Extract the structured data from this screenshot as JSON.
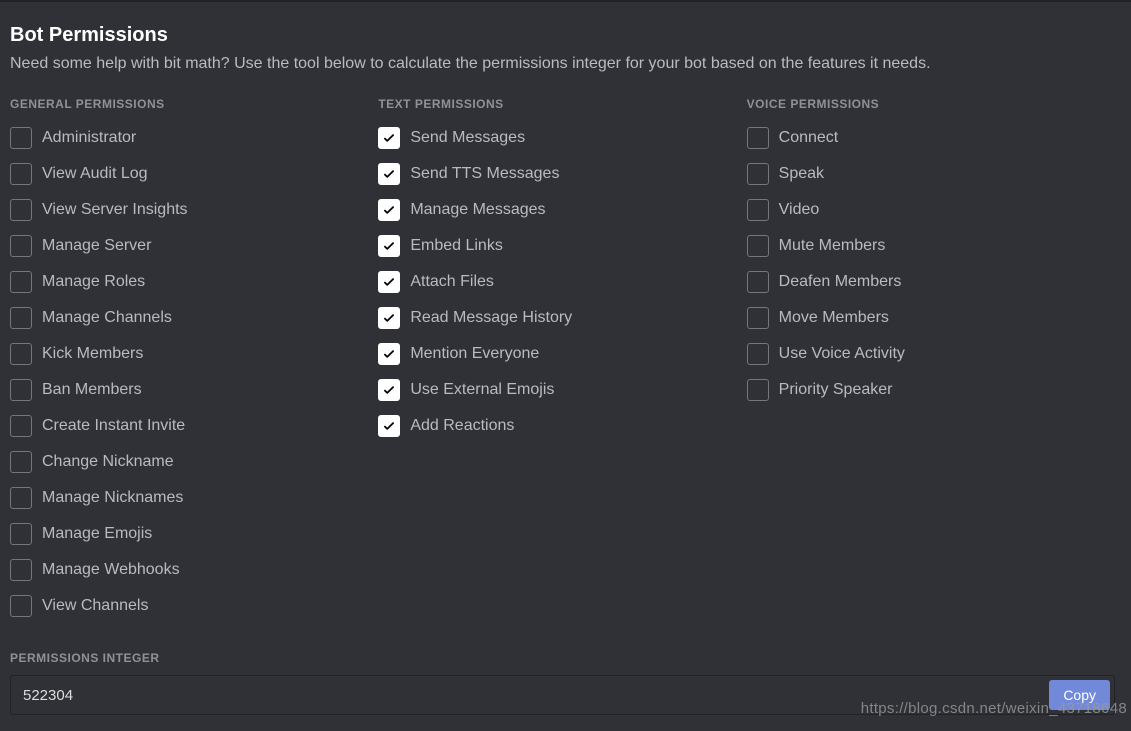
{
  "title": "Bot Permissions",
  "subtitle": "Need some help with bit math? Use the tool below to calculate the permissions integer for your bot based on the features it needs.",
  "columns": {
    "general": {
      "header": "GENERAL PERMISSIONS",
      "items": [
        {
          "label": "Administrator",
          "checked": false
        },
        {
          "label": "View Audit Log",
          "checked": false
        },
        {
          "label": "View Server Insights",
          "checked": false
        },
        {
          "label": "Manage Server",
          "checked": false
        },
        {
          "label": "Manage Roles",
          "checked": false
        },
        {
          "label": "Manage Channels",
          "checked": false
        },
        {
          "label": "Kick Members",
          "checked": false
        },
        {
          "label": "Ban Members",
          "checked": false
        },
        {
          "label": "Create Instant Invite",
          "checked": false
        },
        {
          "label": "Change Nickname",
          "checked": false
        },
        {
          "label": "Manage Nicknames",
          "checked": false
        },
        {
          "label": "Manage Emojis",
          "checked": false
        },
        {
          "label": "Manage Webhooks",
          "checked": false
        },
        {
          "label": "View Channels",
          "checked": false
        }
      ]
    },
    "text": {
      "header": "TEXT PERMISSIONS",
      "items": [
        {
          "label": "Send Messages",
          "checked": true
        },
        {
          "label": "Send TTS Messages",
          "checked": true
        },
        {
          "label": "Manage Messages",
          "checked": true
        },
        {
          "label": "Embed Links",
          "checked": true
        },
        {
          "label": "Attach Files",
          "checked": true
        },
        {
          "label": "Read Message History",
          "checked": true
        },
        {
          "label": "Mention Everyone",
          "checked": true
        },
        {
          "label": "Use External Emojis",
          "checked": true
        },
        {
          "label": "Add Reactions",
          "checked": true
        }
      ]
    },
    "voice": {
      "header": "VOICE PERMISSIONS",
      "items": [
        {
          "label": "Connect",
          "checked": false
        },
        {
          "label": "Speak",
          "checked": false
        },
        {
          "label": "Video",
          "checked": false
        },
        {
          "label": "Mute Members",
          "checked": false
        },
        {
          "label": "Deafen Members",
          "checked": false
        },
        {
          "label": "Move Members",
          "checked": false
        },
        {
          "label": "Use Voice Activity",
          "checked": false
        },
        {
          "label": "Priority Speaker",
          "checked": false
        }
      ]
    }
  },
  "integer": {
    "header": "PERMISSIONS INTEGER",
    "value": "522304",
    "copy_label": "Copy"
  },
  "watermark": "https://blog.csdn.net/weixin_43718648"
}
